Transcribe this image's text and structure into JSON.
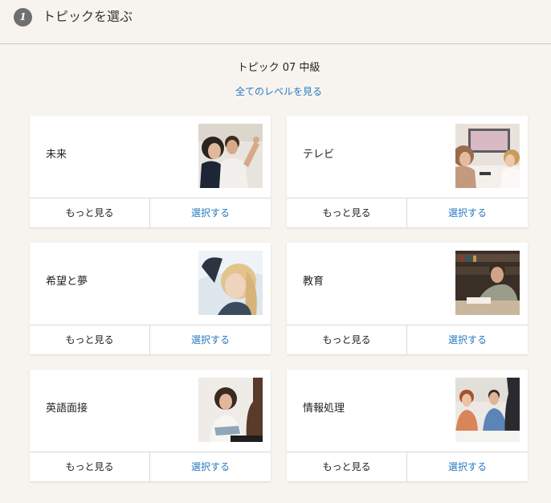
{
  "header": {
    "step_number": "1",
    "title": "トピックを選ぶ"
  },
  "topic_heading": "トピック 07 中級",
  "all_levels_link": "全てのレベルを見る",
  "cards": [
    {
      "name": "未来",
      "more_label": "もっと見る",
      "select_label": "選択する",
      "image": "couple-photo"
    },
    {
      "name": "テレビ",
      "more_label": "もっと見る",
      "select_label": "選択する",
      "image": "watching-tv-photo"
    },
    {
      "name": "希望と夢",
      "more_label": "もっと見る",
      "select_label": "選択する",
      "image": "dreaming-woman-photo"
    },
    {
      "name": "教育",
      "more_label": "もっと見る",
      "select_label": "選択する",
      "image": "studying-man-photo"
    },
    {
      "name": "英語面接",
      "more_label": "もっと見る",
      "select_label": "選択する",
      "image": "interview-photo"
    },
    {
      "name": "情報処理",
      "more_label": "もっと見る",
      "select_label": "選択する",
      "image": "office-meeting-photo"
    }
  ]
}
